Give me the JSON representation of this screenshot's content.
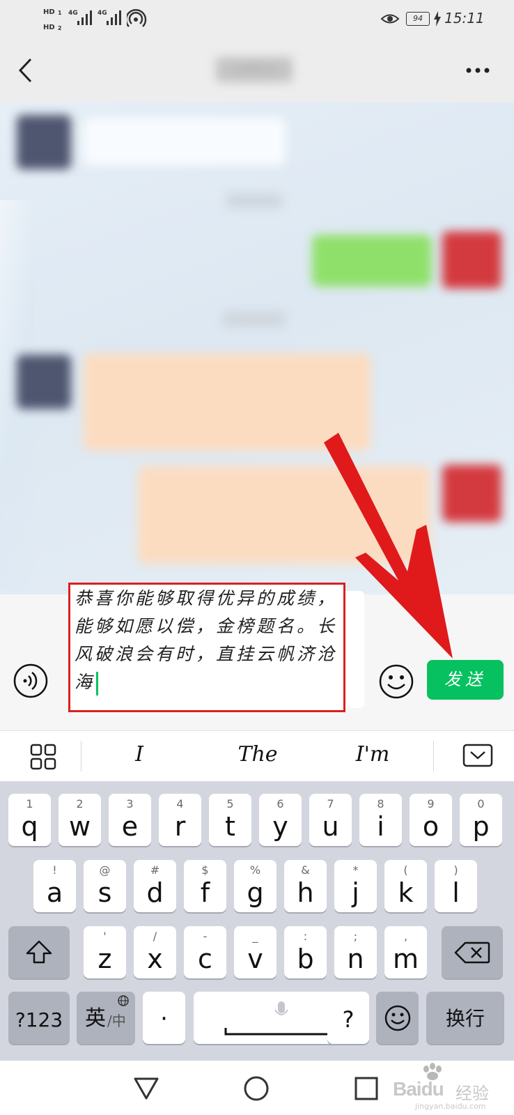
{
  "status_bar": {
    "hd1": "HD",
    "hd2": "HD",
    "net1": "4G",
    "net2": "4G",
    "battery": "94",
    "time": "15:11"
  },
  "header": {
    "title": "刘明洋"
  },
  "composer": {
    "text": "恭喜你能够取得优异的成绩，能够如愿以偿，金榜题名。长风破浪会有时，直挂云帆济沧海",
    "send_label": "发送"
  },
  "suggestions": [
    "I",
    "The",
    "I'm"
  ],
  "keyboard": {
    "row1": [
      {
        "label": "q",
        "hint": "1"
      },
      {
        "label": "w",
        "hint": "2"
      },
      {
        "label": "e",
        "hint": "3"
      },
      {
        "label": "r",
        "hint": "4"
      },
      {
        "label": "t",
        "hint": "5"
      },
      {
        "label": "y",
        "hint": "6"
      },
      {
        "label": "u",
        "hint": "7"
      },
      {
        "label": "i",
        "hint": "8"
      },
      {
        "label": "o",
        "hint": "9"
      },
      {
        "label": "p",
        "hint": "0"
      }
    ],
    "row2": [
      {
        "label": "a",
        "hint": "!"
      },
      {
        "label": "s",
        "hint": "@"
      },
      {
        "label": "d",
        "hint": "#"
      },
      {
        "label": "f",
        "hint": "$"
      },
      {
        "label": "g",
        "hint": "%"
      },
      {
        "label": "h",
        "hint": "&"
      },
      {
        "label": "j",
        "hint": "*"
      },
      {
        "label": "k",
        "hint": "("
      },
      {
        "label": "l",
        "hint": ")"
      }
    ],
    "row3": [
      {
        "label": "z",
        "hint": "'"
      },
      {
        "label": "x",
        "hint": "/"
      },
      {
        "label": "c",
        "hint": "-"
      },
      {
        "label": "v",
        "hint": "_"
      },
      {
        "label": "b",
        "hint": ":"
      },
      {
        "label": "n",
        "hint": ";"
      },
      {
        "label": "m",
        "hint": ","
      }
    ],
    "numbers_key": "?123",
    "lang_key": "英",
    "lang_key_sub": "/中",
    "period_key": "·",
    "question_key": "?",
    "enter_key": "换行"
  },
  "watermark": {
    "brand": "Bai",
    "brand2": "du",
    "cn": "经验",
    "url": "jingyan.baidu.com"
  },
  "colors": {
    "send_green": "#07c160",
    "annotation_red": "#e0191b",
    "outgoing_bubble": "#95ec69",
    "blurred_card": "#fcdcc0"
  }
}
